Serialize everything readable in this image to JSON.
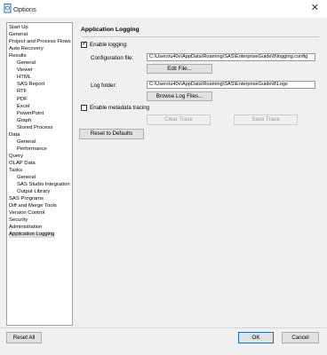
{
  "window": {
    "title": "Options",
    "close_glyph": "✕",
    "app_icon": "document-icon"
  },
  "tree": {
    "items": [
      {
        "label": "Start Up",
        "indent": 0
      },
      {
        "label": "General",
        "indent": 0
      },
      {
        "label": "Project and Process Flows",
        "indent": 0
      },
      {
        "label": "Auto Recovery",
        "indent": 0
      },
      {
        "label": "Results",
        "indent": 0
      },
      {
        "label": "General",
        "indent": 1
      },
      {
        "label": "Viewer",
        "indent": 1
      },
      {
        "label": "HTML",
        "indent": 1
      },
      {
        "label": "SAS Report",
        "indent": 1
      },
      {
        "label": "RTF",
        "indent": 1
      },
      {
        "label": "PDF",
        "indent": 1
      },
      {
        "label": "Excel",
        "indent": 1
      },
      {
        "label": "PowerPoint",
        "indent": 1
      },
      {
        "label": "Graph",
        "indent": 1
      },
      {
        "label": "Stored Process",
        "indent": 1
      },
      {
        "label": "Data",
        "indent": 0
      },
      {
        "label": "General",
        "indent": 1
      },
      {
        "label": "Performance",
        "indent": 1
      },
      {
        "label": "Query",
        "indent": 0
      },
      {
        "label": "OLAP Data",
        "indent": 0
      },
      {
        "label": "Tasks",
        "indent": 0
      },
      {
        "label": "General",
        "indent": 1
      },
      {
        "label": "SAS Studio Integration",
        "indent": 1
      },
      {
        "label": "Output Library",
        "indent": 1
      },
      {
        "label": "SAS Programs",
        "indent": 0
      },
      {
        "label": "Diff and Merge Tools",
        "indent": 0
      },
      {
        "label": "Version Control",
        "indent": 0
      },
      {
        "label": "Security",
        "indent": 0
      },
      {
        "label": "Administration",
        "indent": 0
      },
      {
        "label": "Application Logging",
        "indent": 0,
        "selected": true
      }
    ]
  },
  "panel": {
    "heading": "Application Logging",
    "enable_logging": {
      "label": "Enable logging:",
      "checked": true,
      "check_glyph": "✓"
    },
    "config_file": {
      "label": "Configuration file:",
      "value": "C:\\Users\\u40v\\AppData\\Roaming\\SAS\\EnterpriseGuide\\8\\logging.config",
      "button": "Edit File..."
    },
    "log_folder": {
      "label": "Log folder:",
      "value": "C:\\Users\\u40v\\AppData\\Roaming\\SAS\\EnterpriseGuide\\8\\Logs",
      "button": "Browse Log Files..."
    },
    "metadata_tracing": {
      "label": "Enable metadata tracing",
      "checked": false
    },
    "clear_trace": "Clear Trace",
    "save_trace": "Save Trace",
    "reset_defaults": "Reset to Defaults"
  },
  "footer": {
    "reset_all": "Reset All",
    "ok": "OK",
    "cancel": "Cancel"
  }
}
